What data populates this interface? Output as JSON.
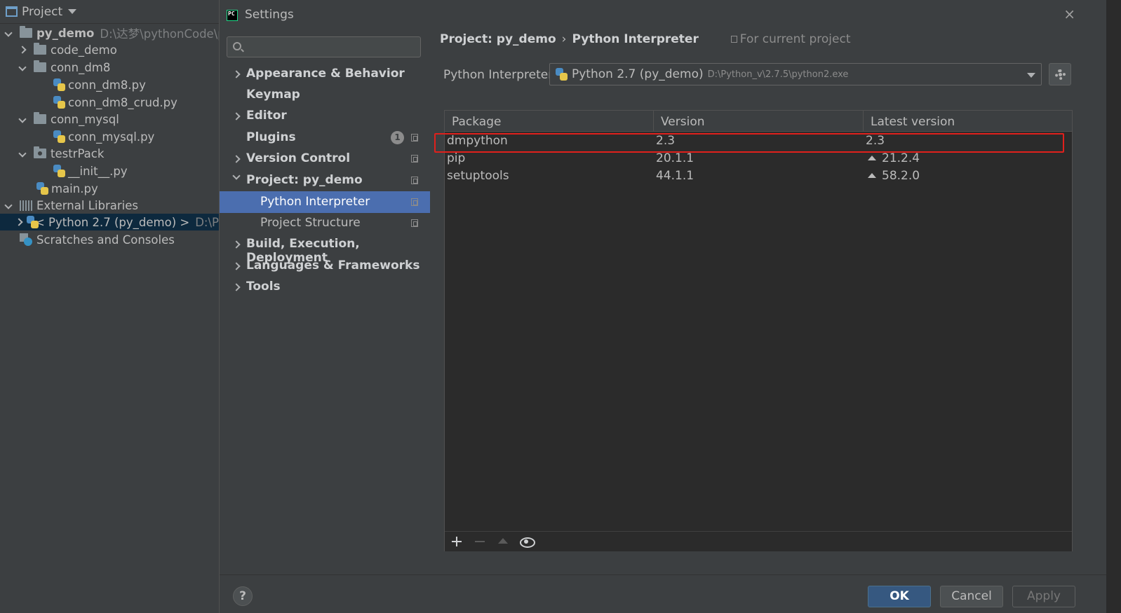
{
  "project_panel": {
    "title": "Project",
    "tree": [
      {
        "label": "py_demo",
        "path": "D:\\达梦\\pythonCode\\py",
        "expanded": true,
        "icon": "folder-icon"
      },
      {
        "label": "code_demo",
        "expanded": false,
        "icon": "folder-icon"
      },
      {
        "label": "conn_dm8",
        "expanded": true,
        "icon": "folder-icon"
      },
      {
        "label": "conn_dm8.py",
        "icon": "python-file-icon"
      },
      {
        "label": "conn_dm8_crud.py",
        "icon": "python-file-icon"
      },
      {
        "label": "conn_mysql",
        "expanded": true,
        "icon": "folder-icon"
      },
      {
        "label": "conn_mysql.py",
        "icon": "python-file-icon"
      },
      {
        "label": "testrPack",
        "expanded": true,
        "icon": "package-icon"
      },
      {
        "label": "__init__.py",
        "icon": "python-file-icon"
      },
      {
        "label": "main.py",
        "icon": "python-file-icon"
      },
      {
        "label": "External Libraries",
        "expanded": true,
        "icon": "library-icon"
      },
      {
        "label": "< Python 2.7 (py_demo) >",
        "path": "D:\\P",
        "expanded": false,
        "icon": "python-sdk-icon",
        "selected": true
      },
      {
        "label": "Scratches and Consoles",
        "icon": "scratches-icon"
      }
    ]
  },
  "dialog": {
    "title": "Settings",
    "app_icon_text": "PC",
    "close_label": "×",
    "search_placeholder": "",
    "nav": [
      {
        "label": "Appearance & Behavior",
        "arrow": "right"
      },
      {
        "label": "Keymap"
      },
      {
        "label": "Editor",
        "arrow": "right"
      },
      {
        "label": "Plugins",
        "badge": "1"
      },
      {
        "label": "Version Control",
        "arrow": "right"
      },
      {
        "label": "Project: py_demo",
        "arrow": "down"
      },
      {
        "label": "Python Interpreter",
        "sub": true,
        "active": true
      },
      {
        "label": "Project Structure",
        "sub": true
      },
      {
        "label": "Build, Execution, Deployment",
        "arrow": "right"
      },
      {
        "label": "Languages & Frameworks",
        "arrow": "right"
      },
      {
        "label": "Tools",
        "arrow": "right"
      }
    ],
    "breadcrumb": {
      "parent": "Project: py_demo",
      "separator": "›",
      "current": "Python Interpreter",
      "scope": "For current project"
    },
    "interpreter": {
      "label": "Python Interpreter:",
      "name": "Python 2.7 (py_demo)",
      "path": "D:\\Python_v\\2.7.5\\python2.exe"
    },
    "packages": {
      "columns": [
        "Package",
        "Version",
        "Latest version"
      ],
      "rows": [
        {
          "package": "dmpython",
          "version": "2.3",
          "latest": "2.3",
          "upgrade": false
        },
        {
          "package": "pip",
          "version": "20.1.1",
          "latest": "21.2.4",
          "upgrade": true
        },
        {
          "package": "setuptools",
          "version": "44.1.1",
          "latest": "58.2.0",
          "upgrade": true
        }
      ],
      "highlighted_row": "dmpython"
    },
    "buttons": {
      "help": "?",
      "ok": "OK",
      "cancel": "Cancel",
      "apply": "Apply"
    },
    "colors": {
      "accent_selected": "#4b6eaf",
      "highlight_box": "#e0201c",
      "ok_button": "#365880"
    }
  }
}
